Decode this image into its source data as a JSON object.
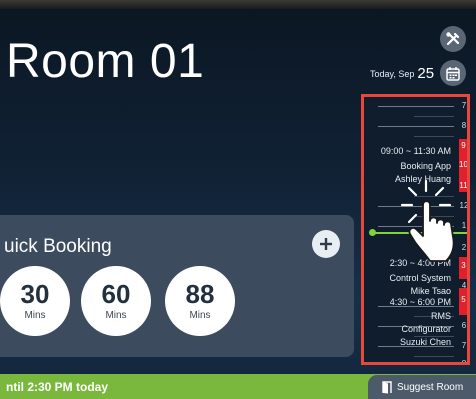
{
  "room": {
    "title": "Room 01"
  },
  "header": {
    "date_prefix": "Today, Sep",
    "date_day": "25"
  },
  "icons": {
    "tools": "tools-icon",
    "calendar": "calendar-icon",
    "add": "plus-icon",
    "suggest": "door-icon",
    "tap": "tap-hand-icon"
  },
  "schedule": {
    "hours_free": [
      "7",
      "8",
      "12",
      "1",
      "2",
      "4",
      "6",
      "7",
      "8"
    ],
    "hours_busy": [
      "9",
      "10",
      "11",
      "3",
      "5"
    ],
    "events": [
      {
        "time": "09:00 ~ 11:30 AM",
        "title": "Booking App",
        "organizer": "Ashley Huang"
      },
      {
        "time": "2:30 ~ 4:00 PM",
        "title": "Control System",
        "organizer": "Mike Tsao"
      },
      {
        "time": "4:30 ~ 6:00 PM",
        "title": "RMS",
        "organizer": ""
      },
      {
        "time": "",
        "title": "Configurator",
        "organizer": "Suzuki Chen"
      }
    ]
  },
  "quick_booking": {
    "title": "uick Booking",
    "options": [
      {
        "value": "30",
        "unit": "Mins"
      },
      {
        "value": "60",
        "unit": "Mins"
      },
      {
        "value": "88",
        "unit": "Mins"
      }
    ]
  },
  "status": {
    "text": "ntil 2:30 PM today",
    "suggest_label": "Suggest Room"
  },
  "colors": {
    "available": "#7ab83d",
    "busy": "#e0202a",
    "highlight_border": "#e8473c"
  }
}
